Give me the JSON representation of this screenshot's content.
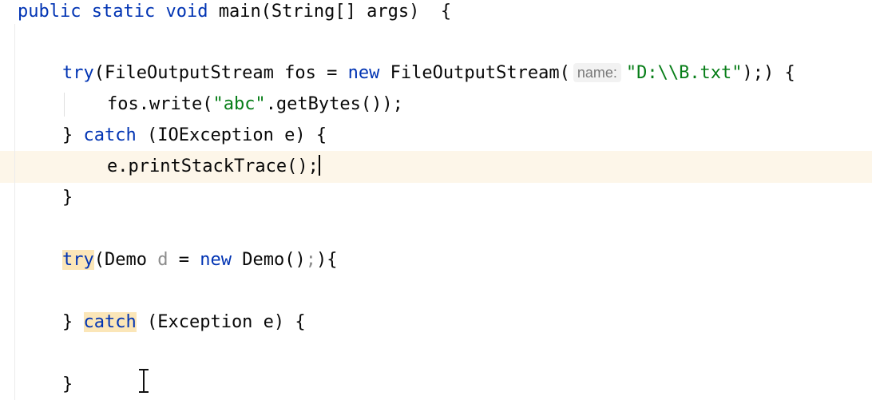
{
  "editor": {
    "caret_line_color": "#fdf6e9",
    "colors": {
      "keyword": "#0033b3",
      "string": "#067d17",
      "unused": "#8c8c8c",
      "highlight": "#fbe6b8"
    },
    "lines": {
      "l1": {
        "kw_public": "public",
        "kw_static": "static",
        "kw_void": "void",
        "rest": "main(String[] args)  {"
      },
      "l2": {
        "kw_try": "try",
        "part_a": "(FileOutputStream fos = ",
        "kw_new": "new",
        "part_b": "FileOutputStream(",
        "hint": "name:",
        "str": "\"D:\\\\B.txt\"",
        "part_c": ");) {"
      },
      "l3": {
        "part_a": "fos.write(",
        "str": "\"abc\"",
        "part_b": ".getBytes());"
      },
      "l4": {
        "brace": "} ",
        "kw_catch": "catch",
        "rest": " (IOException e) {"
      },
      "l5": {
        "text": "e.printStackTrace();"
      },
      "l6": {
        "text": "}"
      },
      "l7": {
        "kw_try": "try",
        "part_a": "(Demo ",
        "var_d": "d",
        "part_b": " = ",
        "kw_new": "new",
        "part_c": " Demo()",
        "semi": ";",
        "part_d": "){"
      },
      "l8": {
        "brace": "} ",
        "kw_catch": "catch",
        "rest": " (Exception e) {"
      },
      "l9": {
        "text": "}"
      }
    }
  }
}
